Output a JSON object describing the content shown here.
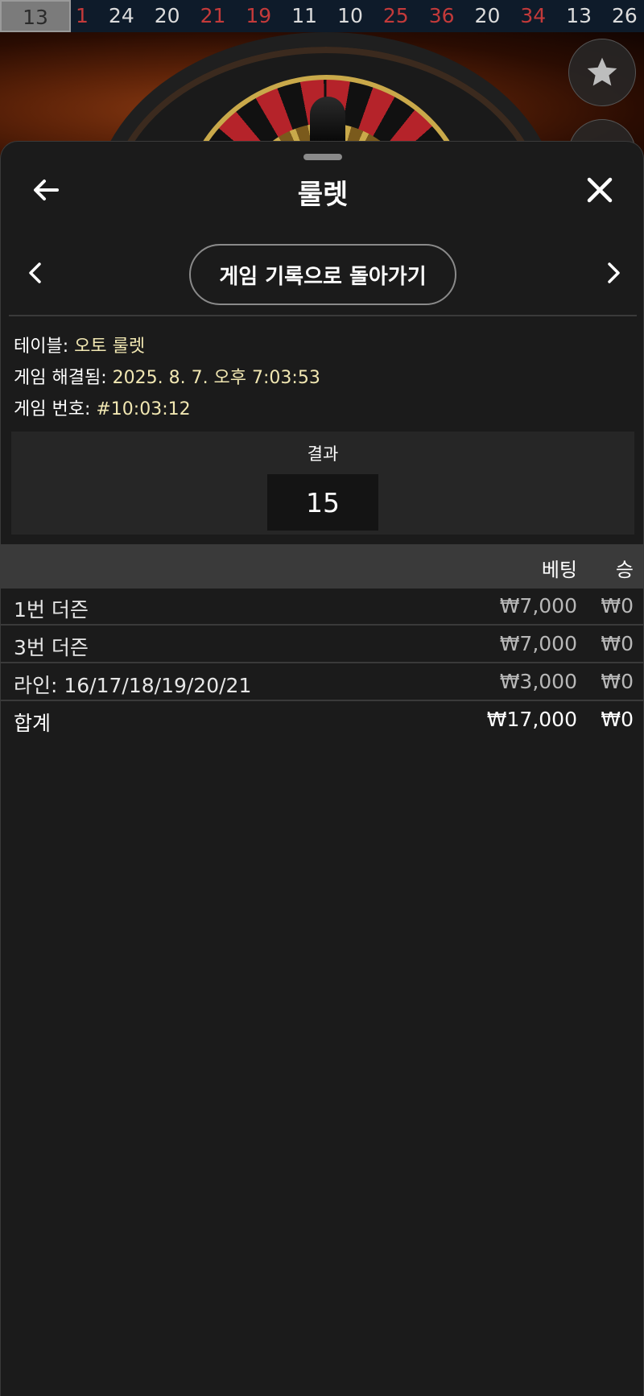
{
  "history_strip": {
    "current": "13",
    "numbers": [
      {
        "value": "1",
        "color": "red"
      },
      {
        "value": "24",
        "color": "black"
      },
      {
        "value": "20",
        "color": "black"
      },
      {
        "value": "21",
        "color": "red"
      },
      {
        "value": "19",
        "color": "red"
      },
      {
        "value": "11",
        "color": "black"
      },
      {
        "value": "10",
        "color": "black"
      },
      {
        "value": "25",
        "color": "red"
      },
      {
        "value": "36",
        "color": "red"
      },
      {
        "value": "20",
        "color": "black"
      },
      {
        "value": "34",
        "color": "red"
      },
      {
        "value": "13",
        "color": "black"
      },
      {
        "value": "26",
        "color": "black"
      }
    ]
  },
  "sheet": {
    "title": "룰렛",
    "back_icon": "arrow-left-icon",
    "close_icon": "close-icon",
    "nav": {
      "prev_icon": "chevron-left-icon",
      "next_icon": "chevron-right-icon",
      "back_to_history_label": "게임 기록으로 돌아가기"
    },
    "info": {
      "table_label": "테이블:",
      "table_value": "오토 룰렛",
      "resolved_label": "게임 해결됨:",
      "resolved_value": "2025. 8. 7. 오후 7:03:53",
      "game_no_label": "게임 번호:",
      "game_no_value": "#10:03:12"
    },
    "result": {
      "label": "결과",
      "value": "15"
    },
    "bets_table": {
      "headers": {
        "bet": "베팅",
        "win": "승"
      },
      "rows": [
        {
          "name": "1번 더즌",
          "bet": "₩7,000",
          "win": "₩0"
        },
        {
          "name": "3번 더즌",
          "bet": "₩7,000",
          "win": "₩0"
        },
        {
          "name": "라인: 16/17/18/19/20/21",
          "bet": "₩3,000",
          "win": "₩0"
        }
      ],
      "total": {
        "name": "합계",
        "bet": "₩17,000",
        "win": "₩0"
      }
    }
  },
  "colors": {
    "red_number": "#c33a3a",
    "info_value": "#f1e7b2",
    "sheet_bg": "#1b1b1b",
    "table_header_bg": "#3a3a3a"
  },
  "favorite_icon": "star-icon"
}
